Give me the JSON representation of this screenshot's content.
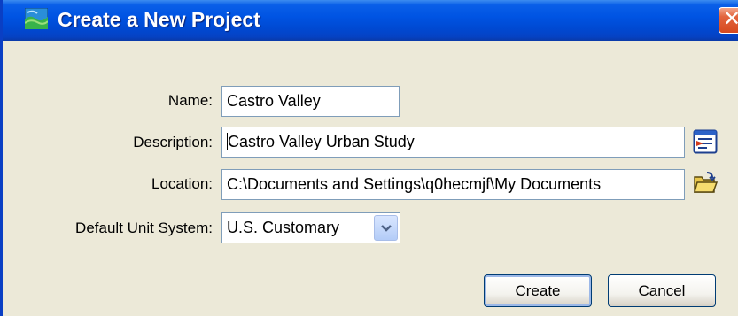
{
  "window": {
    "title": "Create a New Project",
    "close_glyph": "✕",
    "icon": "project-landscape-icon"
  },
  "form": {
    "name": {
      "label": "Name:",
      "value": "Castro Valley"
    },
    "description": {
      "label": "Description:",
      "value": "Castro Valley Urban Study",
      "side_icon": "edit-description-icon"
    },
    "location": {
      "label": "Location:",
      "value": "C:\\Documents and Settings\\q0hecmjf\\My Documents",
      "side_icon": "browse-folder-icon"
    },
    "unit_system": {
      "label": "Default Unit System:",
      "value": "U.S. Customary",
      "arrow_icon": "chevron-down-icon"
    }
  },
  "buttons": {
    "create": "Create",
    "cancel": "Cancel"
  },
  "colors": {
    "titlebar": "#0054e3",
    "dialog_bg": "#ece9d8",
    "close_button": "#d64a1f",
    "field_border": "#7f9db9"
  }
}
